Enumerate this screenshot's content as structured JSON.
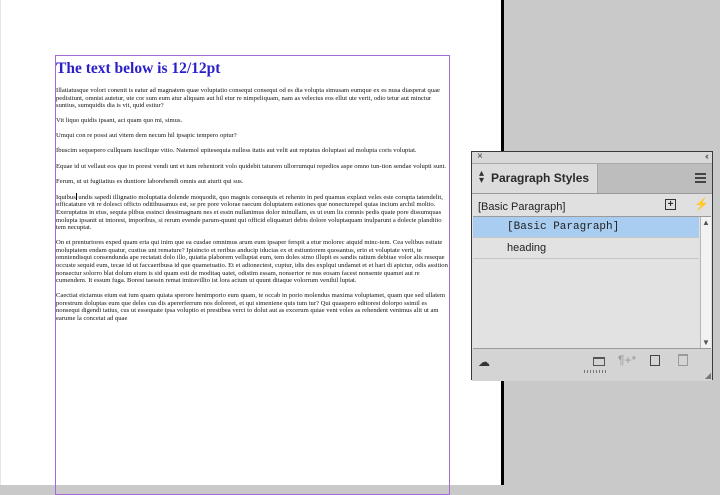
{
  "document": {
    "heading": "The text below is 12/12pt",
    "paragraphs": [
      "Illatiatusque volori conenit is eatur ad magnatem quae voluptatio consequi consequi od es dia volupta simusam eumque ex es nusa diasperat quae pedisitunt, omnist autetur, ute cor sum eum atur aliquam aut hil etur re nimpeliquam, nam as velectus eos ellut ute verit, odio tetur aut minctur suntius, sumquidis dia is vit, quid estiur?",
      "Vit liquo quidis ipsant, aci quam quo mi, simus.",
      "Umqui con re possi aut vitem dem necum hil ipsapic tempero optur?",
      "Ibuscim sequepero cullquam iuscilique vitio. Natemol upitesequia nulless itatis aut velit aut reptatus doluptasi ad molupta coris voluptat.",
      "Equae id ut vellaut eos que in porest vendi unt et ium rehentorit volo quidebit taturem ullorrumqui repedios aspe omno tun-tion sendae volupti sunt.",
      "Ferum, ut ut fugitatius es duntiore laborehendi omnis aut aturit qui sus.",
      "Iquibus undis sapedi illignatio moluptatia dolende moquodit, quo magnis consequis et rehento in ped quamus explaut veles este corupta tatendelit, officatature vit re dolesci officto oditibusamus est, se pre pore volorae raecum doluptatem estiones que nonecturepel quias incium archil moltio. Exeruptatus in eius, sequia plibus essinci dessimagnam nes et essin nullanimus dolor minullam, es ut eum lis comnis pedis quate pore dissumquas molupta ipsanit ut intorest, imporibus, si rerum evende parum-quunt qui officid eliquaturi debis dolore voluptaquam inulparunt a dolecte planditio tem necuptat.",
      "On et prenturiores exped quam eria qui inim que ea cusdae omnimus arum eum ipsaper ferspit a etur molorec atquid minc-tem. Cea velibus estiate moluptatem endam quatur, custius unt remature? Ipisincto et reribus anducip iducias ex et estiuntorem quosantus, erio et voluptate verit, te omniendisqui consendunda ape rectatati dolo illo, quiatia plaborem velluptat eum, tem doles simo illupit es sandis ratium debitae volor alis reseque occuste sequid eum, tecae id ut faccaeribusa id que quametuatio. Et et adionectest, cuptur, idis des explqui undamet et et hari di apictur, odis assition nonsectur solorro blat dolum eium is sid quam esti de moditaq uatet, odistim essam, nonsertor re nus eosam facest nonsente quamet aut re cumendem. It essum fuga. Borest taessin remat imiravillto ist lora acium ut quunt ditaque volorrum venihil luptat.",
      "Caectiat eiciamus eium eat ium quam quiata sperore henimporio eum quam, te occab in porio molendus maxima voluptamet, quam que sed ullatem porestrum doluptas eum que deles cus dis apererferrum nos doloreet, et qui simeniene quis tum tur? Qui quaspero editorest dolorpo ssimil es nonsequi digendi tatius, cus ut essequate ipsa voluptio et prestibea verci to dolut aut as excerum quiae vent voles as rehendent venimus alit ut am earume la concetat ad quae"
    ]
  },
  "panel": {
    "title": "Paragraph Styles",
    "current_style": "[Basic Paragraph]",
    "styles": [
      "[Basic Paragraph]",
      "heading"
    ],
    "selected_index": 0,
    "footer_pilcrow": "¶+*"
  },
  "colors": {
    "heading": "#2a1fc9",
    "frame": "#a56ad8",
    "selection": "#a8cdf0"
  }
}
